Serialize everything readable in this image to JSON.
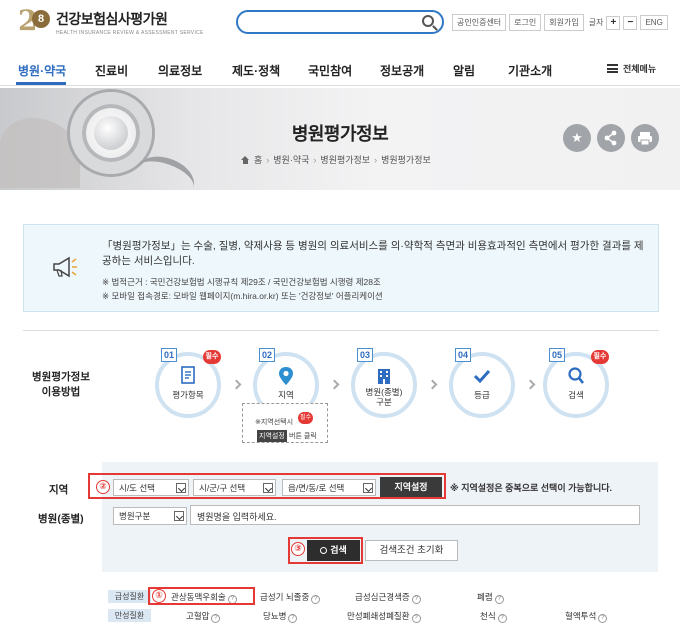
{
  "header": {
    "logo_title": "건강보험심사평가원",
    "logo_subtitle": "HEALTH INSURANCE REVIEW & ASSESSMENT SERVICE",
    "search_placeholder": "",
    "util_links": [
      "공인인증센터",
      "로그인",
      "회원가입"
    ],
    "font_size_label": "글자",
    "font_plus": "+",
    "font_minus": "−",
    "lang": "ENG"
  },
  "nav": {
    "items": [
      "병원·약국",
      "진료비",
      "의료정보",
      "제도·정책",
      "국민참여",
      "정보공개",
      "알림",
      "기관소개"
    ],
    "all_menu": "전체메뉴"
  },
  "hero": {
    "title": "병원평가정보",
    "breadcrumb": [
      "홈",
      "병원·약국",
      "병원평가정보",
      "병원평가정보"
    ]
  },
  "info": {
    "text": "「병원평가정보」는 수술, 질병, 약제사용 등 병원의 의료서비스를 의·약학적 측면과 비용효과적인 측면에서 평가한 결과를 제공하는 서비스입니다.",
    "notes": [
      "※ 법적근거 : 국민건강보험법 시행규칙 제29조 / 국민건강보험법 시행령 제28조",
      "※ 모바일 접속경로: 모바일 웹페이지(m.hira.or.kr) 또는 '건강정보' 어플리케이션"
    ]
  },
  "steps": {
    "label_line1": "병원평가정보",
    "label_line2": "이용방법",
    "required": "필수",
    "items": [
      {
        "num": "01",
        "label": "평가항목",
        "required": true
      },
      {
        "num": "02",
        "label": "지역",
        "required": false
      },
      {
        "num": "03",
        "label": "병원(종별)\n구분",
        "required": false
      },
      {
        "num": "04",
        "label": "등급",
        "required": false
      },
      {
        "num": "05",
        "label": "검색",
        "required": true
      }
    ],
    "hint_line1": "※지역선택시",
    "hint_btn": "지역설정",
    "hint_line2": "버튼 클릭"
  },
  "form": {
    "region_label": "지역",
    "hospital_label": "병원(종별)",
    "sido": "시/도 선택",
    "sigungu": "시/군/구 선택",
    "dong": "읍/면/동/로 선택",
    "region_button": "지역설정",
    "region_note": "※ 지역설정은 중복으로 선택이 가능합니다.",
    "hospital_type": "병원구분",
    "hospital_name_placeholder": "병원명을 입력하세요.",
    "search_button": "검색",
    "reset_button": "검색조건 초기화",
    "markers": [
      "②",
      "③",
      "①"
    ]
  },
  "diseases": {
    "rows": [
      {
        "category": "급성질환",
        "items": [
          "관상동맥우회술",
          "급성기 뇌졸중",
          "급성심근경색증",
          "폐렴"
        ]
      },
      {
        "category": "만성질환",
        "items": [
          "고혈압",
          "당뇨병",
          "만성폐쇄성폐질환",
          "천식",
          "혈액투석"
        ]
      }
    ]
  },
  "colors": {
    "accent": "#2d6cc0",
    "highlight": "#e53935",
    "button_dark": "#2d2d2d"
  }
}
